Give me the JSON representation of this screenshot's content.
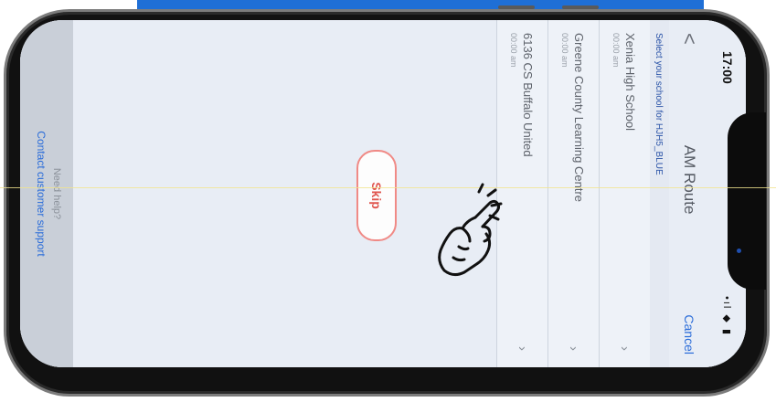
{
  "status_bar": {
    "time": "17:00",
    "icons": [
      "signal-icon",
      "wifi-icon",
      "battery-icon"
    ],
    "icons_text": "•ıl ◆ ▮"
  },
  "nav": {
    "back": "<",
    "title": "AM Route",
    "cancel": "Cancel"
  },
  "list": {
    "header": "Select your school for HJH5_BLUE",
    "schools": [
      {
        "name": "Xenia High School",
        "time": "00:00 am"
      },
      {
        "name": "Greene County Learning Centre",
        "time": "00:00 am"
      },
      {
        "name": "6136 CS Buffalo United",
        "time": "00:00 am"
      }
    ],
    "chevron": "›"
  },
  "actions": {
    "skip": "Skip"
  },
  "footer": {
    "need_help": "Need help?",
    "contact": "Contact customer support"
  },
  "colors": {
    "accent": "#2a6cd9",
    "skip": "#e0564f",
    "frame_top_bar": "#1f6fd6"
  }
}
